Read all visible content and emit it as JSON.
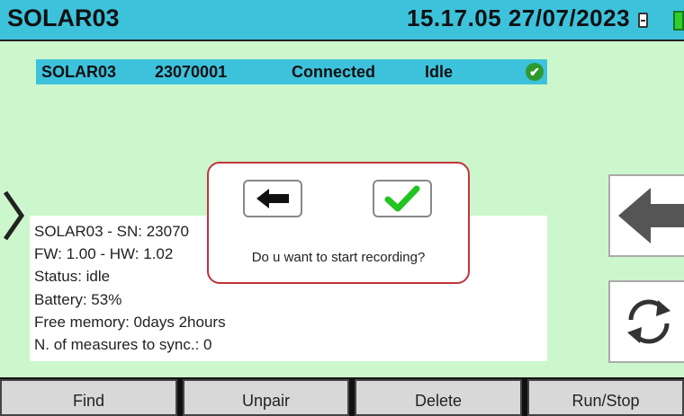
{
  "header": {
    "title": "SOLAR03",
    "datetime": "15.17.05 27/07/2023",
    "sd_icon": "sd-card-icon",
    "battery_icon": "battery-icon"
  },
  "device_row": {
    "name": "SOLAR03",
    "serial": "23070001",
    "connection": "Connected",
    "state": "Idle",
    "status_icon": "check-circle-icon"
  },
  "info": {
    "lines": [
      "SOLAR03 - SN: 23070",
      "FW: 1.00 - HW: 1.02",
      "Status: idle",
      "Battery: 53%",
      "Free memory: 0days 2hours",
      "N. of measures to sync.: 0"
    ]
  },
  "dialog": {
    "message": "Do u want to start recording?",
    "cancel_icon": "arrow-left-icon",
    "confirm_icon": "checkmark-icon"
  },
  "side_buttons": {
    "back_icon": "arrow-left-icon",
    "refresh_icon": "refresh-icon"
  },
  "footer": {
    "buttons": [
      "Find",
      "Unpair",
      "Delete",
      "Run/Stop"
    ]
  },
  "colors": {
    "header_bg": "#3dc2dc",
    "screen_bg": "#ccf7cc",
    "dialog_border": "#c0353a",
    "confirm_green": "#22c322"
  }
}
